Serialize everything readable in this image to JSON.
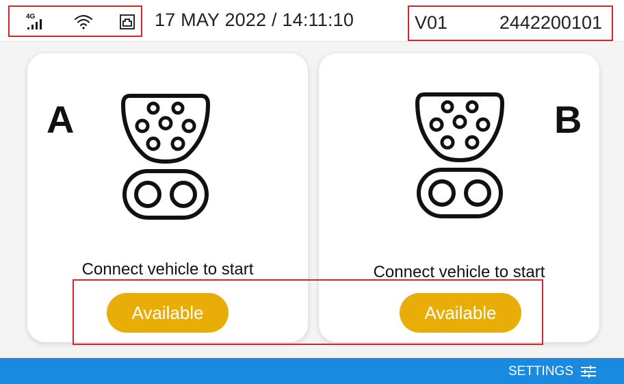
{
  "status_bar": {
    "network_label": "4G",
    "datetime": "17 MAY 2022 / 14:11:10",
    "version": "V01",
    "serial": "2442200101",
    "icons": [
      "cellular-4g-icon",
      "wifi-icon",
      "ethernet-icon"
    ]
  },
  "connectors": [
    {
      "letter": "A",
      "prompt": "Connect vehicle to start",
      "status": "Available",
      "icon": "ccs2-connector-icon"
    },
    {
      "letter": "B",
      "prompt": "Connect vehicle to start",
      "status": "Available",
      "icon": "ccs2-connector-icon"
    }
  ],
  "footer": {
    "settings_label": "SETTINGS",
    "icon": "settings-sliders-icon"
  },
  "colors": {
    "status_available": "#e9ad08",
    "footer_bar": "#1a8ae0",
    "highlight": "#d9232a"
  }
}
